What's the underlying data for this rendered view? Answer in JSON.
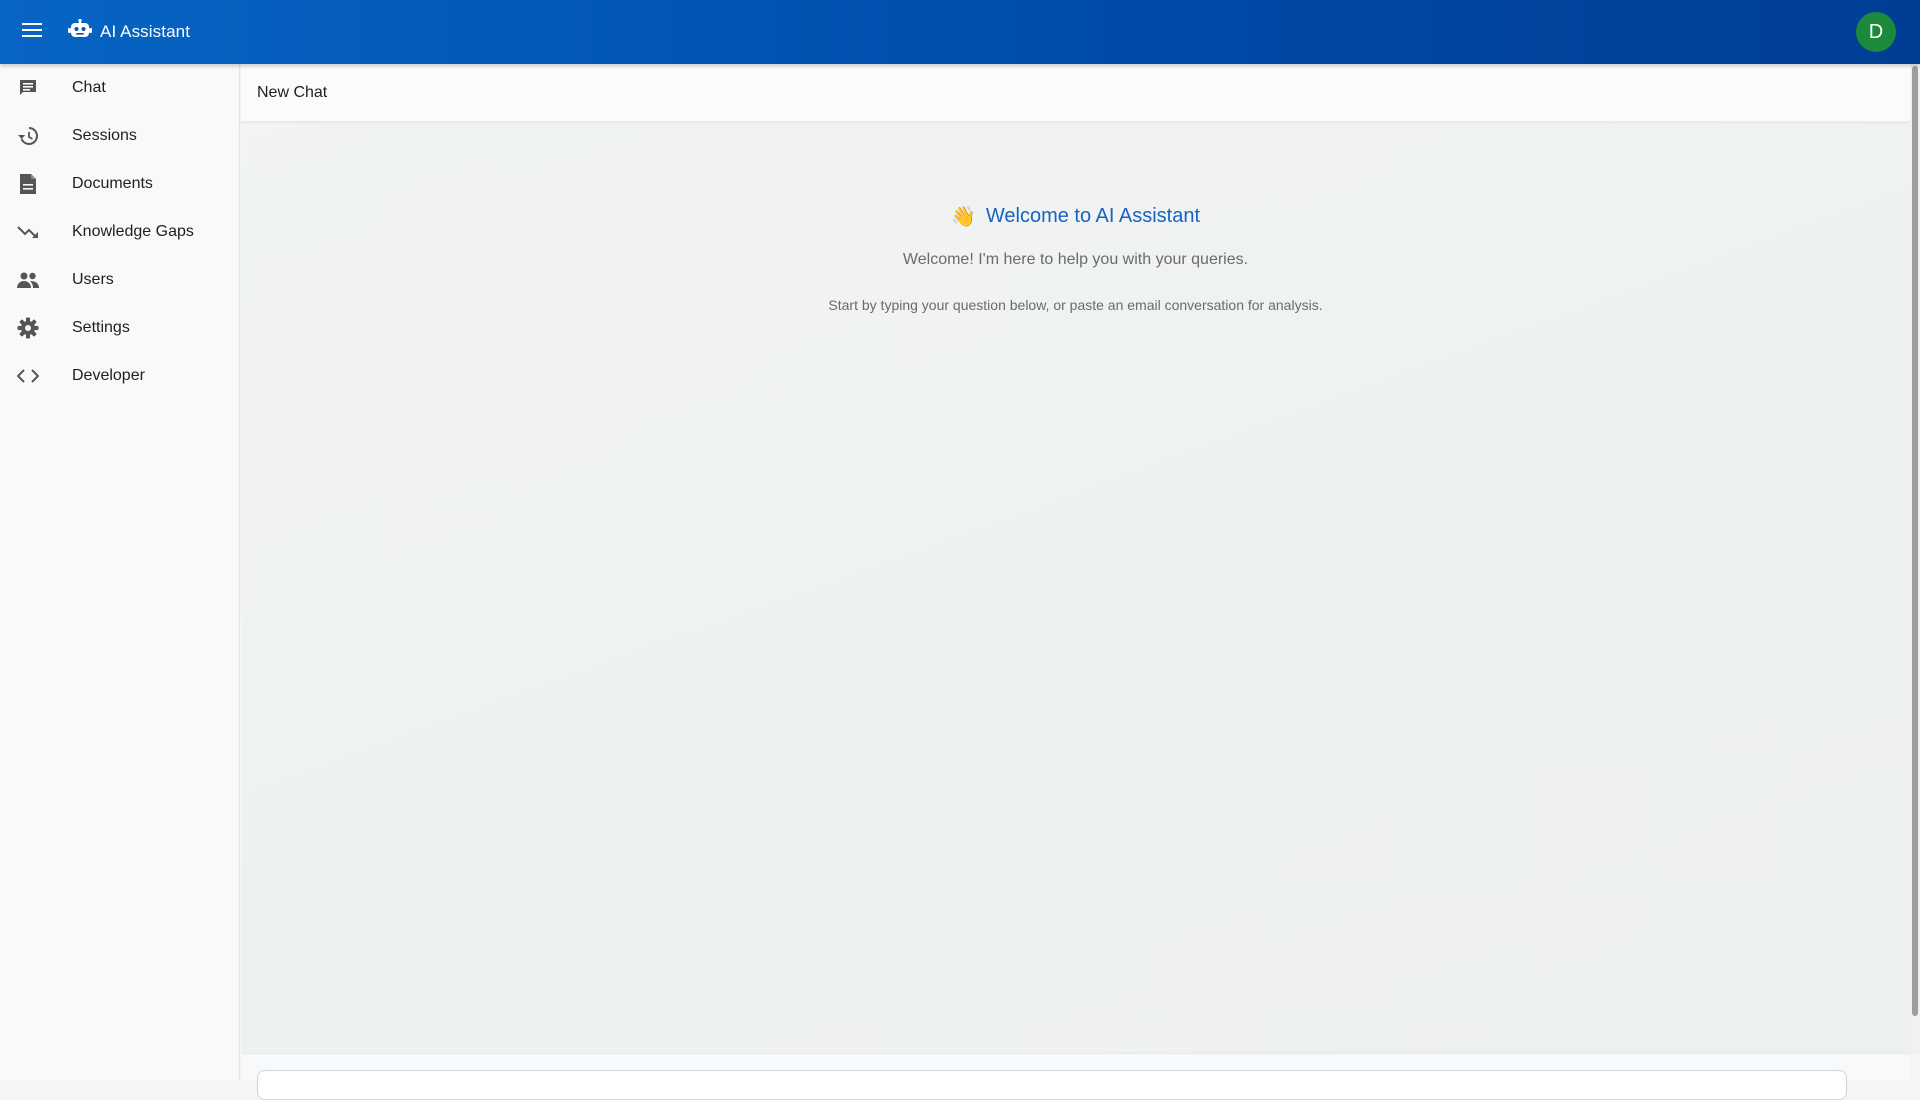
{
  "app": {
    "title": "AI Assistant",
    "brand_color": "#0a5ac0",
    "user_initial": "D",
    "avatar_color": "#1b8a3a"
  },
  "sidebar": {
    "items": [
      {
        "label": "Chat",
        "icon": "chat-icon"
      },
      {
        "label": "Sessions",
        "icon": "history-icon"
      },
      {
        "label": "Documents",
        "icon": "document-icon"
      },
      {
        "label": "Knowledge Gaps",
        "icon": "trending-down-icon"
      },
      {
        "label": "Users",
        "icon": "users-icon"
      },
      {
        "label": "Settings",
        "icon": "gear-icon"
      },
      {
        "label": "Developer",
        "icon": "code-icon"
      }
    ]
  },
  "main": {
    "header_title": "New Chat",
    "welcome_title": "Welcome to AI Assistant",
    "welcome_emoji": "👋",
    "welcome_subtitle": "Welcome! I'm here to help you with your queries.",
    "welcome_hint": "Start by typing your question below, or paste an email conversation for analysis."
  }
}
